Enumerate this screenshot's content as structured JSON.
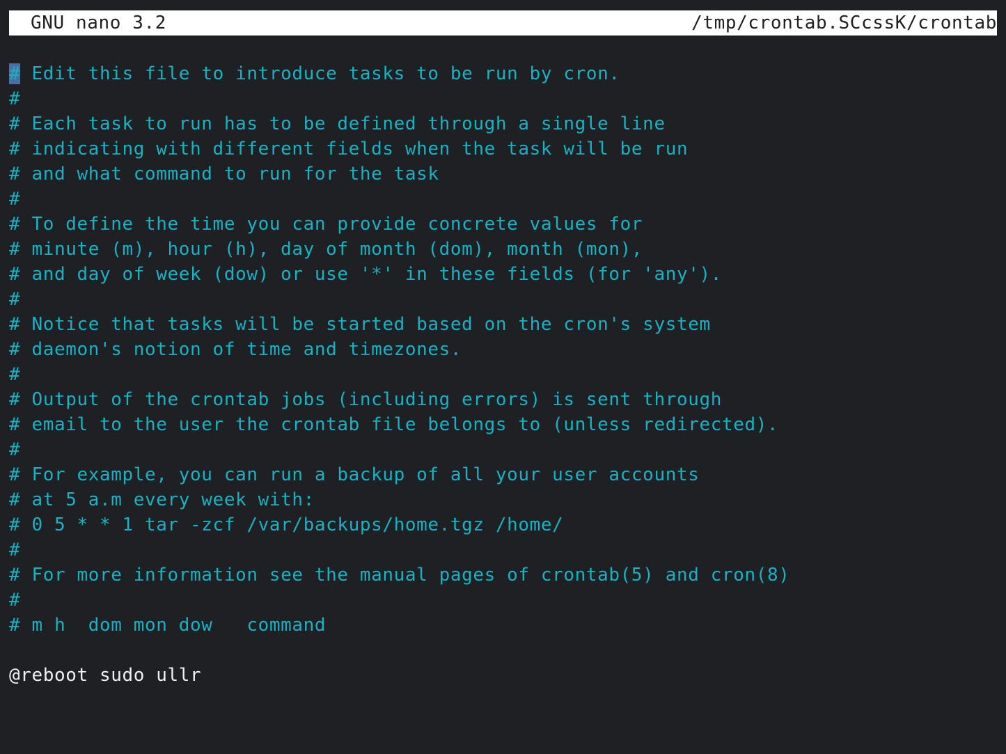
{
  "titlebar": {
    "app": "GNU nano 3.2",
    "file_path": "/tmp/crontab.SCcssK/crontab"
  },
  "editor": {
    "cursor_char": "#",
    "lines": [
      {
        "text": " Edit this file to introduce tasks to be run by cron.",
        "kind": "comment-cursor"
      },
      {
        "text": "#",
        "kind": "comment"
      },
      {
        "text": "# Each task to run has to be defined through a single line",
        "kind": "comment"
      },
      {
        "text": "# indicating with different fields when the task will be run",
        "kind": "comment"
      },
      {
        "text": "# and what command to run for the task",
        "kind": "comment"
      },
      {
        "text": "#",
        "kind": "comment"
      },
      {
        "text": "# To define the time you can provide concrete values for",
        "kind": "comment"
      },
      {
        "text": "# minute (m), hour (h), day of month (dom), month (mon),",
        "kind": "comment"
      },
      {
        "text": "# and day of week (dow) or use '*' in these fields (for 'any').",
        "kind": "comment"
      },
      {
        "text": "#",
        "kind": "comment"
      },
      {
        "text": "# Notice that tasks will be started based on the cron's system",
        "kind": "comment"
      },
      {
        "text": "# daemon's notion of time and timezones.",
        "kind": "comment"
      },
      {
        "text": "#",
        "kind": "comment"
      },
      {
        "text": "# Output of the crontab jobs (including errors) is sent through",
        "kind": "comment"
      },
      {
        "text": "# email to the user the crontab file belongs to (unless redirected).",
        "kind": "comment"
      },
      {
        "text": "#",
        "kind": "comment"
      },
      {
        "text": "# For example, you can run a backup of all your user accounts",
        "kind": "comment"
      },
      {
        "text": "# at 5 a.m every week with:",
        "kind": "comment"
      },
      {
        "text": "# 0 5 * * 1 tar -zcf /var/backups/home.tgz /home/",
        "kind": "comment"
      },
      {
        "text": "#",
        "kind": "comment"
      },
      {
        "text": "# For more information see the manual pages of crontab(5) and cron(8)",
        "kind": "comment"
      },
      {
        "text": "#",
        "kind": "comment"
      },
      {
        "text": "# m h  dom mon dow   command",
        "kind": "comment"
      },
      {
        "text": "",
        "kind": "blank"
      },
      {
        "text": "@reboot sudo ullr",
        "kind": "code"
      }
    ]
  }
}
